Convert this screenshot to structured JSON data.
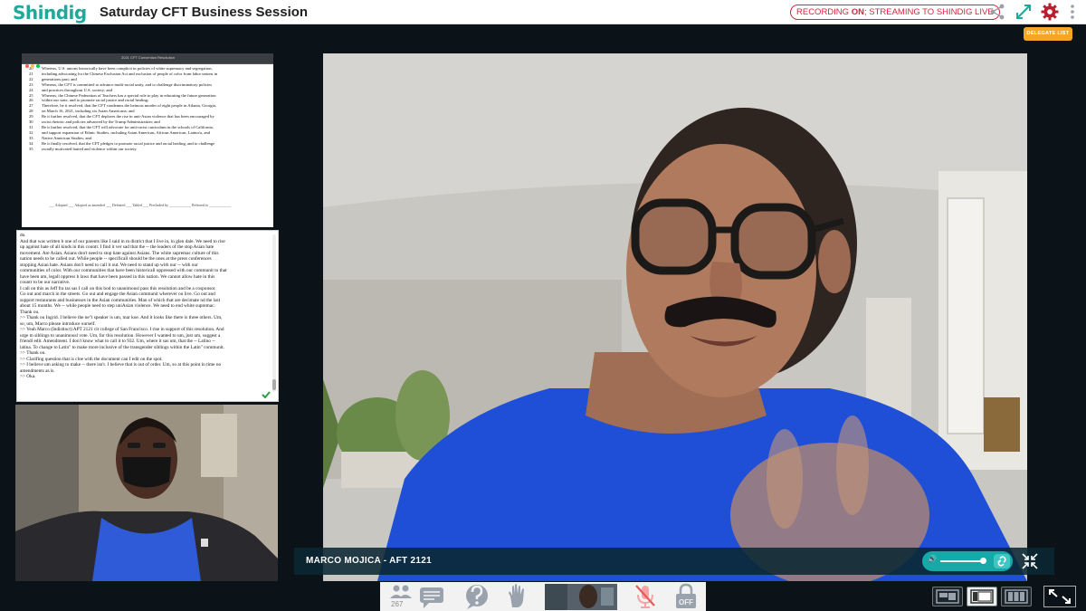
{
  "header": {
    "logo": "Shindig",
    "title": "Saturday CFT Business Session",
    "recording_prefix": "RECORDING ",
    "recording_on": "ON",
    "recording_suffix": "; STREAMING TO SHINDIG LIVE"
  },
  "delegate_list_label": "DELEGATE LIST",
  "document": {
    "filename": "2021 CFT Convention Resolution",
    "lines": [
      {
        "n": "20",
        "t": "Whereas, U.S. unions historically have been complicit in policies of white supremacy and segregation,"
      },
      {
        "n": "21",
        "t": "including advocating for the Chinese Exclusion Act and exclusion of people of color from labor unions in"
      },
      {
        "n": "22",
        "t": "generations past; and"
      },
      {
        "n": "23",
        "t": "Whereas, the CFT is committed to advance multi-racial unity, and to challenge discriminatory policies"
      },
      {
        "n": "24",
        "t": "and practices throughout U.S. society; and"
      },
      {
        "n": "25",
        "t": "Whereas, the Chinese Federation of Teachers has a special role to play in educating the future generation"
      },
      {
        "n": "26",
        "t": "within our state, and to promote racial justice and racial healing;"
      },
      {
        "n": "27",
        "t": "Therefore, be it resolved, that the CFT condemns the heinous murder of eight people in Atlanta, Georgia,"
      },
      {
        "n": "28",
        "t": "on March 16, 2021, including six Asian Americans; and"
      },
      {
        "n": "29",
        "t": "Be it further resolved, that the CFT deplores the rise in anti-Asian violence that has been encouraged by"
      },
      {
        "n": "30",
        "t": "racist rhetoric and policies advanced by the Trump Administration; and"
      },
      {
        "n": "31",
        "t": "Be it further resolved, that the CFT will advocate for anti-racist curriculum in the schools of California,"
      },
      {
        "n": "32",
        "t": "and support expansion of Ethnic Studies, including Asian American, African American, Latino/a, and"
      },
      {
        "n": "33",
        "t": "Native American Studies; and"
      },
      {
        "n": "34",
        "t": "Be it finally resolved, that the CFT pledges to promote racial justice and racial healing, and to challenge"
      },
      {
        "n": "35",
        "t": "racially motivated hatred and violence within our society."
      }
    ],
    "footer": "___ Adopted ___ Adopted as amended ___ Defeated ___ Tabled ___ Precluded by ____________ Referred to ____________"
  },
  "transcript": {
    "lines": [
      "do.",
      "And that was written b one of our parents like I said in m district that I live in, in glen dale.  We need to rise",
      "up against hate of all kinds in this countr.  I find it ver sad that the -- the leaders of the stop Asian hate",
      "movement.  Are Asian.  Asians don't need to stop hate against Asians.  The white supremac culture of this",
      "nation needs to be called out.  While people -- specificall should be the ones at the press conferences",
      "stopping Asian hate.  Asians don't need to call it out.  We need to stand up with our -- with our",
      "communities of color.  With our communities that have been historicall oppressed with our communit to that",
      "have been um, legall oppress b laws that have been passed in this nation.  We cannot allow hate in this",
      "countr to be our narrative.",
      "I call on this as Jeff fra tas sas I call on this bod to unanimousl pass this resolution and be a cosponsor.",
      "Go out and march in the streets.  Go out and engage the Asian communit wherever ou live.  Go out and",
      "support restaurants and businesses in the Asian communities.  Man of which that are decimate nd the last",
      "about 15 months.  We -- while people need to step uniAsian violence. We need to end white supremac.",
      "Thank ou.",
      ">> Thank ou Ingrid.  I believe the ne\"t speaker is um, mar koe.  And it looks like there is three others.  Um,",
      "so, um, Marco please introduce ourself.",
      ">> Yeah Marco (Indistinct) APT 2121 cit college of San Francisco.  I rise in support of this resolution.  And",
      "urge m siblings to unanimousl vote.  Um, for this resolution.  However I wanted to um, just um, suggest a",
      "friendl edit.  Amendment.  I don't know what to call it to 932.  Um, where it sas um, that the -- Latino --",
      "latina.  To change to Latin\" to make more inclusive of the transgender siblings within the Latin\" communit.",
      ">> Thank ou.",
      ">> Clarifing question that is cloe with the document can I edit on the spot.",
      ">> I believe um asking to make -- there isn't.  I believe that is out of order.  Um, so at this point in time no",
      "amendments as is.",
      ">> Oka."
    ]
  },
  "main_video": {
    "speaker_name": "MARCO MOJICA - AFT 2121"
  },
  "bottom_bar": {
    "participant_count": "267",
    "lock_label": "OFF"
  },
  "icons": {
    "share": "share-icon",
    "expand": "expand-icon",
    "settings": "gear-icon",
    "more": "more-vertical-icon",
    "people": "people-icon",
    "chat": "chat-icon",
    "help": "help-icon",
    "hand": "raise-hand-icon",
    "mic": "mic-muted-icon",
    "lock": "lock-icon",
    "check": "check-icon",
    "collapse": "collapse-icon",
    "fullscreen": "exit-fullscreen-icon",
    "speaker": "speaker-icon",
    "link": "link-icon"
  },
  "colors": {
    "brand": "#1fa89c",
    "recording": "#d7263d",
    "settings": "#b81e2e",
    "accent_orange": "#f5a623",
    "teal_control": "#16a9a8",
    "shirt_blue": "#1f4fd6"
  },
  "volume": {
    "level": 0.8
  }
}
